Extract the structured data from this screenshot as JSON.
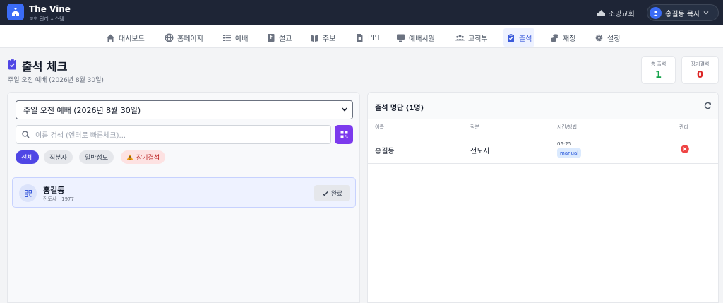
{
  "brand": {
    "title": "The Vine",
    "subtitle": "교회 관리 시스템"
  },
  "top": {
    "church_link": "소망교회",
    "user_name": "홍길동 목사"
  },
  "nav": {
    "items": [
      {
        "label": "대시보드",
        "icon": "home-icon"
      },
      {
        "label": "홈페이지",
        "icon": "globe-icon"
      },
      {
        "label": "예배",
        "icon": "list-icon"
      },
      {
        "label": "설교",
        "icon": "bible-icon"
      },
      {
        "label": "주보",
        "icon": "book-icon"
      },
      {
        "label": "PPT",
        "icon": "file-icon"
      },
      {
        "label": "예배시원",
        "icon": "monitor-icon"
      },
      {
        "label": "교적부",
        "icon": "users-icon"
      },
      {
        "label": "출석",
        "icon": "clipboard-check-icon",
        "active": true
      },
      {
        "label": "재정",
        "icon": "coins-icon"
      },
      {
        "label": "설정",
        "icon": "gear-icon"
      }
    ]
  },
  "header": {
    "title": "출석 체크",
    "subtitle": "주일 오전 예배 (2026년 8월 30일)",
    "stats": [
      {
        "label": "총 출석",
        "value": "1",
        "color": "#16a34a"
      },
      {
        "label": "장기결석",
        "value": "0",
        "color": "#dc2626"
      }
    ]
  },
  "left": {
    "select_value": "주일 오전 예배 (2026년 8월 30일)",
    "search_placeholder": "이름 검색 (엔터로 빠른체크)...",
    "filters": [
      "전체",
      "직분자",
      "일반성도",
      "장기결석"
    ],
    "member": {
      "name": "홍길동",
      "meta": "전도사 | 1977",
      "action": "완료"
    }
  },
  "right": {
    "title": "출석 명단 (1명)",
    "columns": [
      "이름",
      "직분",
      "시간/방법",
      "관리"
    ],
    "rows": [
      {
        "name": "홍길동",
        "role": "전도사",
        "time": "06:25",
        "method": "manual"
      }
    ]
  }
}
